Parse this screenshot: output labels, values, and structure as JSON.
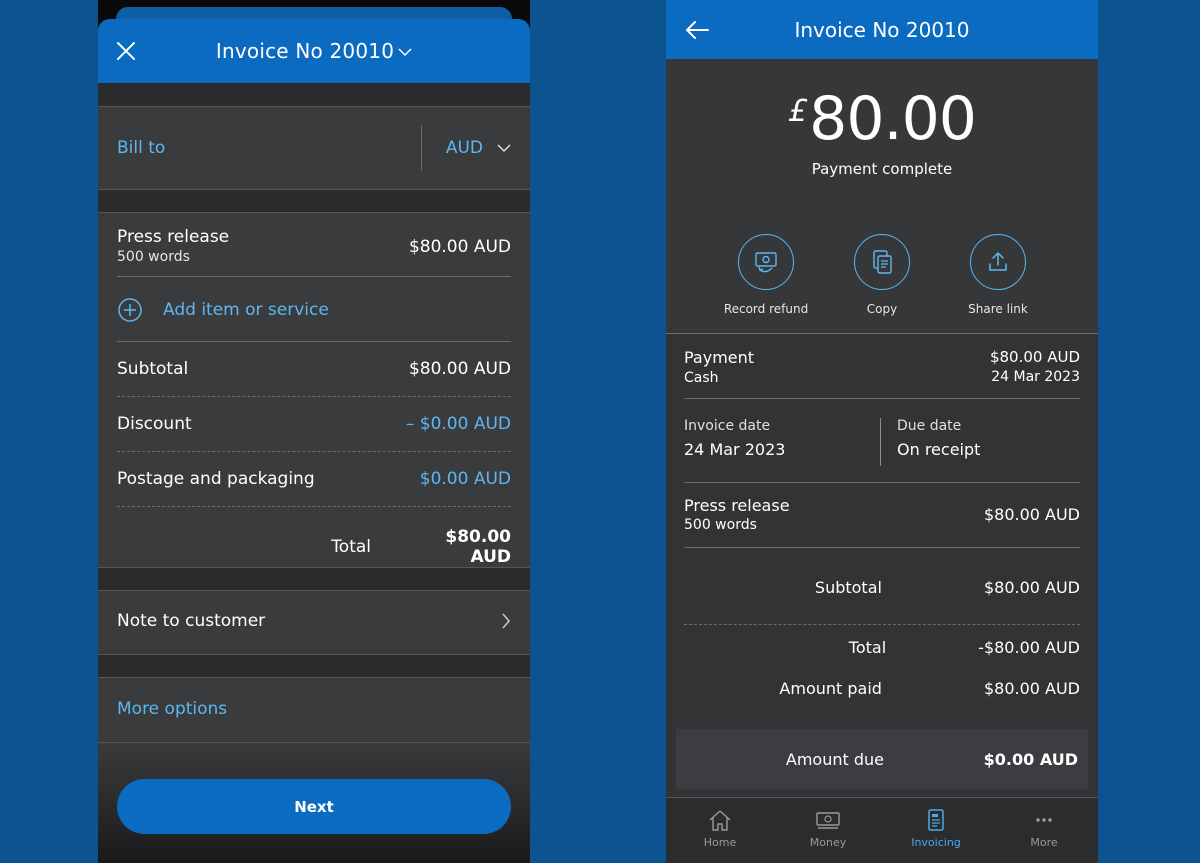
{
  "left": {
    "header": {
      "title": "Invoice No 20010"
    },
    "bill_to": {
      "label": "Bill to",
      "currency": "AUD"
    },
    "item": {
      "name": "Press release",
      "detail": "500 words",
      "price": "$80.00 AUD"
    },
    "add_item": {
      "label": "Add item or service"
    },
    "subtotal": {
      "label": "Subtotal",
      "value": "$80.00 AUD"
    },
    "discount": {
      "label": "Discount",
      "value": "– $0.00 AUD"
    },
    "postage": {
      "label": "Postage and packaging",
      "value": "$0.00 AUD"
    },
    "total": {
      "label": "Total",
      "value": "$80.00 AUD"
    },
    "note": {
      "label": "Note to customer"
    },
    "more_options": {
      "label": "More options"
    },
    "next_button": {
      "label": "Next"
    }
  },
  "right": {
    "header": {
      "title": "Invoice No 20010"
    },
    "amount": {
      "currency_symbol": "£",
      "value": "80.00",
      "status": "Payment complete"
    },
    "actions": [
      {
        "label": "Record refund",
        "icon": "record-refund-icon"
      },
      {
        "label": "Copy",
        "icon": "copy-icon"
      },
      {
        "label": "Share link",
        "icon": "share-icon"
      }
    ],
    "payment": {
      "label": "Payment",
      "method": "Cash",
      "amount": "$80.00 AUD",
      "date": "24 Mar 2023"
    },
    "invoice_date": {
      "label": "Invoice date",
      "value": "24 Mar 2023"
    },
    "due_date": {
      "label": "Due date",
      "value": "On receipt"
    },
    "item": {
      "name": "Press release",
      "detail": "500 words",
      "price": "$80.00 AUD"
    },
    "subtotal": {
      "label": "Subtotal",
      "value": "$80.00 AUD"
    },
    "total": {
      "label": "Total",
      "value": "-$80.00 AUD"
    },
    "amount_paid": {
      "label": "Amount paid",
      "value": "$80.00 AUD"
    },
    "amount_due": {
      "label": "Amount due",
      "value": "$0.00 AUD"
    },
    "tabs": [
      {
        "label": "Home",
        "icon": "home-icon"
      },
      {
        "label": "Money",
        "icon": "money-icon"
      },
      {
        "label": "Invoicing",
        "icon": "invoice-icon"
      },
      {
        "label": "More",
        "icon": "more-dots-icon"
      }
    ],
    "active_tab": "Invoicing"
  },
  "colors": {
    "background": "#0c548f",
    "header_blue": "#0a6bc0",
    "accent_blue": "#5db6f2",
    "panel_dark": "#3a3b3d"
  }
}
